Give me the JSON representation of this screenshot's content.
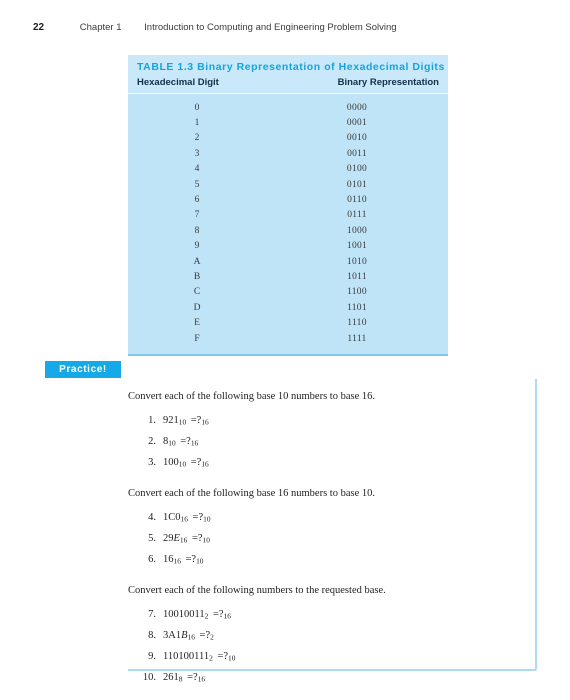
{
  "running_head": {
    "page_number": "22",
    "chapter": "Chapter 1",
    "title": "Introduction to Computing and Engineering Problem Solving"
  },
  "table": {
    "title": "TABLE 1.3   Binary Representation of Hexadecimal Digits",
    "columns": [
      "Hexadecimal Digit",
      "Binary Representation"
    ],
    "rows": [
      {
        "hex": "0",
        "binary": "0000"
      },
      {
        "hex": "1",
        "binary": "0001"
      },
      {
        "hex": "2",
        "binary": "0010"
      },
      {
        "hex": "3",
        "binary": "0011"
      },
      {
        "hex": "4",
        "binary": "0100"
      },
      {
        "hex": "5",
        "binary": "0101"
      },
      {
        "hex": "6",
        "binary": "0110"
      },
      {
        "hex": "7",
        "binary": "0111"
      },
      {
        "hex": "8",
        "binary": "1000"
      },
      {
        "hex": "9",
        "binary": "1001"
      },
      {
        "hex": "A",
        "binary": "1010"
      },
      {
        "hex": "B",
        "binary": "1011"
      },
      {
        "hex": "C",
        "binary": "1100"
      },
      {
        "hex": "D",
        "binary": "1101"
      },
      {
        "hex": "E",
        "binary": "1110"
      },
      {
        "hex": "F",
        "binary": "1111"
      }
    ],
    "colors": {
      "body_background": "#bfe4f7",
      "header_background": "#c9e8f9",
      "title_text": "#16a3dd",
      "bottom_border": "#7ec8ea"
    }
  },
  "practice": {
    "badge_label": "Practice!",
    "badge_color": "#16a9e8",
    "rule_color": "#aadcf2",
    "groups": [
      {
        "prompt": "Convert each of the following base 10 numbers to base 16.",
        "items": [
          {
            "number": "1.",
            "value": "921",
            "base": "10",
            "answer_base": "16",
            "italic_part": ""
          },
          {
            "number": "2.",
            "value": "8",
            "base": "10",
            "answer_base": "16",
            "italic_part": ""
          },
          {
            "number": "3.",
            "value": "100",
            "base": "10",
            "answer_base": "16",
            "italic_part": ""
          }
        ]
      },
      {
        "prompt": "Convert each of the following base 16 numbers to base 10.",
        "items": [
          {
            "number": "4.",
            "value": "1C0",
            "base": "16",
            "answer_base": "10",
            "italic_part": ""
          },
          {
            "number": "5.",
            "value": "29",
            "base": "16",
            "answer_base": "10",
            "italic_part": "E"
          },
          {
            "number": "6.",
            "value": "16",
            "base": "16",
            "answer_base": "10",
            "italic_part": ""
          }
        ]
      },
      {
        "prompt": "Convert each of the following numbers to the requested base.",
        "items": [
          {
            "number": "7.",
            "value": "10010011",
            "base": "2",
            "answer_base": "16",
            "italic_part": ""
          },
          {
            "number": "8.",
            "value": "3A1",
            "base": "16",
            "answer_base": "2",
            "italic_part": "B"
          },
          {
            "number": "9.",
            "value": "110100111",
            "base": "2",
            "answer_base": "10",
            "italic_part": ""
          },
          {
            "number": "10.",
            "value": "261",
            "base": "8",
            "answer_base": "16",
            "italic_part": ""
          }
        ]
      }
    ]
  }
}
